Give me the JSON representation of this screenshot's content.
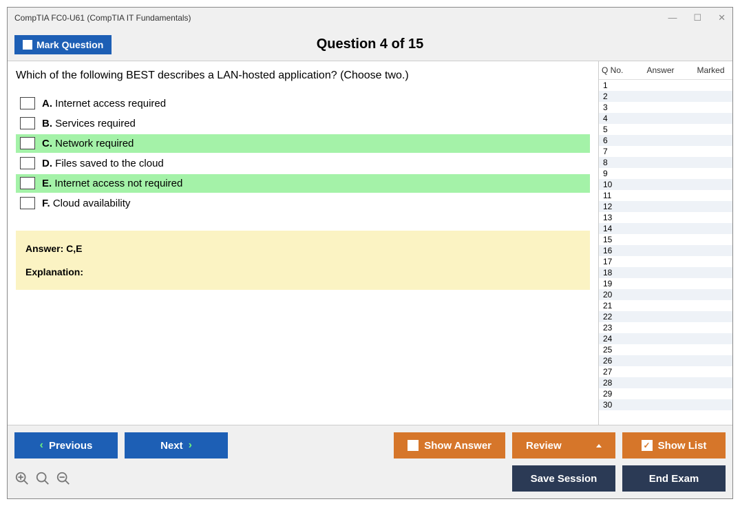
{
  "window": {
    "title": "CompTIA FC0-U61 (CompTIA IT Fundamentals)"
  },
  "header": {
    "mark_label": "Mark Question",
    "question_title": "Question 4 of 15"
  },
  "question": {
    "text": "Which of the following BEST describes a LAN-hosted application? (Choose two.)",
    "options": [
      {
        "letter": "A.",
        "text": "Internet access required",
        "correct": false
      },
      {
        "letter": "B.",
        "text": "Services required",
        "correct": false
      },
      {
        "letter": "C.",
        "text": "Network required",
        "correct": true
      },
      {
        "letter": "D.",
        "text": "Files saved to the cloud",
        "correct": false
      },
      {
        "letter": "E.",
        "text": "Internet access not required",
        "correct": true
      },
      {
        "letter": "F.",
        "text": "Cloud availability",
        "correct": false
      }
    ],
    "answer_label": "Answer: C,E",
    "explanation_label": "Explanation:"
  },
  "sidebar": {
    "col_qno": "Q No.",
    "col_answer": "Answer",
    "col_marked": "Marked",
    "rows": 30
  },
  "footer": {
    "previous": "Previous",
    "next": "Next",
    "show_answer": "Show Answer",
    "review": "Review",
    "show_list": "Show List",
    "save_session": "Save Session",
    "end_exam": "End Exam"
  }
}
